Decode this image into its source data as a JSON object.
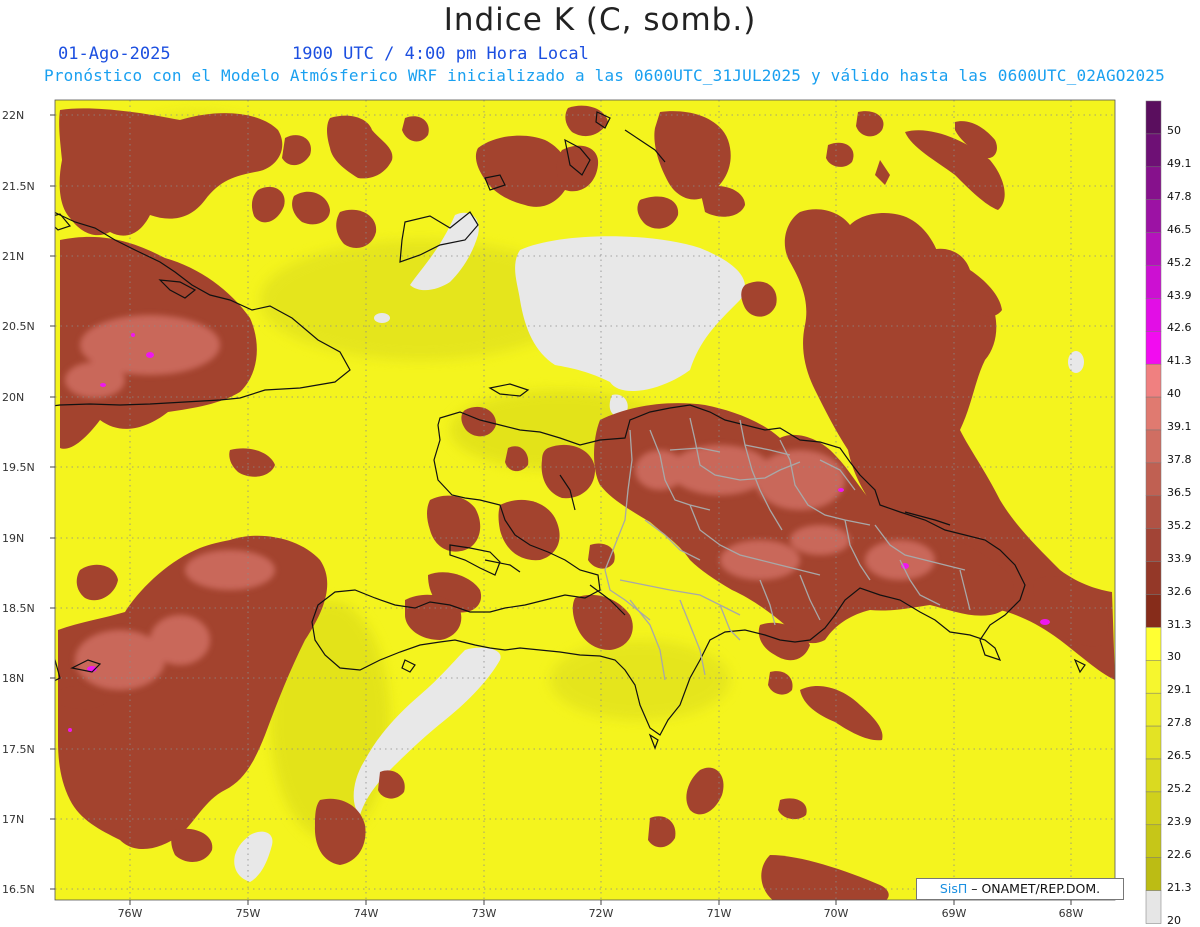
{
  "header": {
    "title": "Indice K (C, somb.)",
    "date": "01-Ago-2025",
    "time": "1900 UTC / 4:00 pm Hora Local",
    "forecast_note": "Pronóstico con el Modelo Atmósferico WRF inicializado a las 0600UTC_31JUL2025 y válido hasta las  0600UTC_02AGO2025"
  },
  "map": {
    "lat_ticks": [
      "22N",
      "21.5N",
      "21N",
      "20.5N",
      "20N",
      "19.5N",
      "19N",
      "18.5N",
      "18N",
      "17.5N",
      "17N",
      "16.5N"
    ],
    "lon_ticks": [
      "76W",
      "75W",
      "74W",
      "73W",
      "72W",
      "71W",
      "70W",
      "69W",
      "68W"
    ],
    "colors": {
      "land_line": "#111111",
      "province_line": "#9a9a9a",
      "no_data": "#e8e8e8"
    }
  },
  "colorbar": {
    "labels": [
      "50",
      "49.1",
      "47.8",
      "46.5",
      "45.2",
      "43.9",
      "42.6",
      "41.3",
      "40",
      "39.1",
      "37.8",
      "36.5",
      "35.2",
      "33.9",
      "32.6",
      "31.3",
      "30",
      "29.1",
      "27.8",
      "26.5",
      "25.2",
      "23.9",
      "22.6",
      "21.3",
      "20"
    ],
    "colors": [
      "#5a0e5e",
      "#6e1075",
      "#86118c",
      "#9c12a4",
      "#b512bc",
      "#cc10d2",
      "#e20ee6",
      "#f20cf0",
      "#f08080",
      "#e07a70",
      "#d06e62",
      "#c06052",
      "#b05244",
      "#a24436",
      "#943828",
      "#862c1a",
      "#ffff33",
      "#f6f62e",
      "#eded29",
      "#e3e324",
      "#dada20",
      "#d0d01c",
      "#c6c618",
      "#bcbc14",
      "#e6e6e6"
    ]
  },
  "credit": {
    "brand": "SisΠ",
    "text": "– ONAMET/REP.DOM."
  }
}
